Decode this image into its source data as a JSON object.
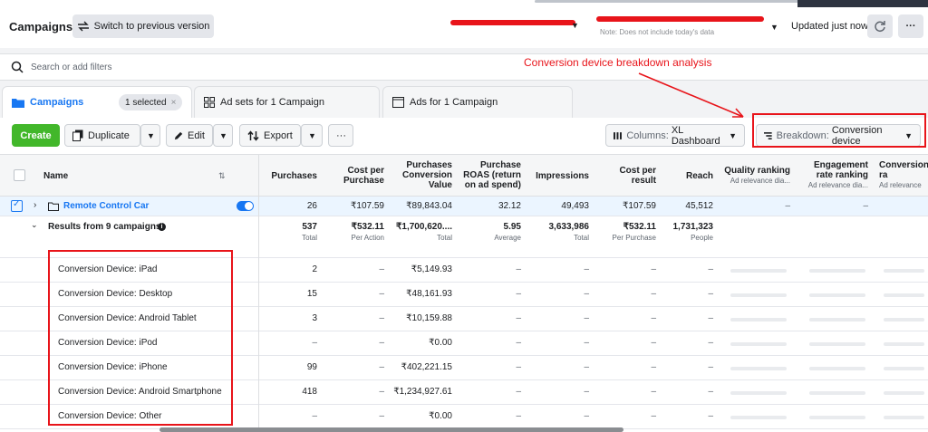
{
  "header": {
    "title": "Campaigns",
    "switch_label": "Switch to previous version",
    "note": "Note: Does not include today's data",
    "updated": "Updated just now"
  },
  "search": {
    "placeholder": "Search or add filters"
  },
  "annotation": "Conversion device breakdown analysis",
  "tabs": {
    "campaigns": "Campaigns",
    "selected": "1 selected",
    "adsets": "Ad sets for 1 Campaign",
    "ads": "Ads for 1 Campaign"
  },
  "toolbar": {
    "create": "Create",
    "duplicate": "Duplicate",
    "edit": "Edit",
    "export": "Export",
    "columns_prefix": "Columns: ",
    "columns_value": "XL Dashboard",
    "breakdown_prefix": "Breakdown: ",
    "breakdown_value": "Conversion device"
  },
  "columns": {
    "name": "Name",
    "purchases": "Purchases",
    "cost_per_purchase_1": "Cost per",
    "cost_per_purchase_2": "Purchase",
    "conv_value_1": "Purchases",
    "conv_value_2": "Conversion",
    "conv_value_3": "Value",
    "roas_1": "Purchase",
    "roas_2": "ROAS (return",
    "roas_3": "on ad spend)",
    "impressions": "Impressions",
    "cost_per_result_1": "Cost per",
    "cost_per_result_2": "result",
    "reach": "Reach",
    "quality_1": "Quality ranking",
    "quality_sub": "Ad relevance dia...",
    "engagement_1": "Engagement",
    "engagement_2": "rate ranking",
    "engagement_sub": "Ad relevance dia...",
    "conversion_1": "Conversion",
    "conversion_2": "ra",
    "conversion_sub": "Ad relevance"
  },
  "campaign_row": {
    "name": "Remote Control Car",
    "purchases": "26",
    "cost_per_purchase": "₹107.59",
    "conv_value": "₹89,843.04",
    "roas": "32.12",
    "impressions": "49,493",
    "cost_per_result": "₹107.59",
    "reach": "45,512",
    "quality": "–",
    "engagement": "–"
  },
  "totals_row": {
    "label": "Results from 9 campaigns",
    "purchases": "537",
    "purchases_sub": "Total",
    "cost_per_purchase": "₹532.11",
    "cost_per_purchase_sub": "Per Action",
    "conv_value": "₹1,700,620....",
    "conv_value_sub": "Total",
    "roas": "5.95",
    "roas_sub": "Average",
    "impressions": "3,633,986",
    "impressions_sub": "Total",
    "cost_per_result": "₹532.11",
    "cost_per_result_sub": "Per Purchase",
    "reach": "1,731,323",
    "reach_sub": "People"
  },
  "breakdown_rows": [
    {
      "label": "Conversion Device: iPad",
      "purchases": "2",
      "cost": "–",
      "value": "₹5,149.93",
      "roas": "–",
      "impressions": "–",
      "cpr": "–",
      "reach": "–"
    },
    {
      "label": "Conversion Device: Desktop",
      "purchases": "15",
      "cost": "–",
      "value": "₹48,161.93",
      "roas": "–",
      "impressions": "–",
      "cpr": "–",
      "reach": "–"
    },
    {
      "label": "Conversion Device: Android Tablet",
      "purchases": "3",
      "cost": "–",
      "value": "₹10,159.88",
      "roas": "–",
      "impressions": "–",
      "cpr": "–",
      "reach": "–"
    },
    {
      "label": "Conversion Device: iPod",
      "purchases": "–",
      "cost": "–",
      "value": "₹0.00",
      "roas": "–",
      "impressions": "–",
      "cpr": "–",
      "reach": "–"
    },
    {
      "label": "Conversion Device: iPhone",
      "purchases": "99",
      "cost": "–",
      "value": "₹402,221.15",
      "roas": "–",
      "impressions": "–",
      "cpr": "–",
      "reach": "–"
    },
    {
      "label": "Conversion Device: Android Smartphone",
      "purchases": "418",
      "cost": "–",
      "value": "₹1,234,927.61",
      "roas": "–",
      "impressions": "–",
      "cpr": "–",
      "reach": "–"
    },
    {
      "label": "Conversion Device: Other",
      "purchases": "–",
      "cost": "–",
      "value": "₹0.00",
      "roas": "–",
      "impressions": "–",
      "cpr": "–",
      "reach": "–"
    }
  ],
  "colors": {
    "accent": "#1877f2",
    "create": "#42b72a",
    "annotation_red": "#e8141a"
  }
}
